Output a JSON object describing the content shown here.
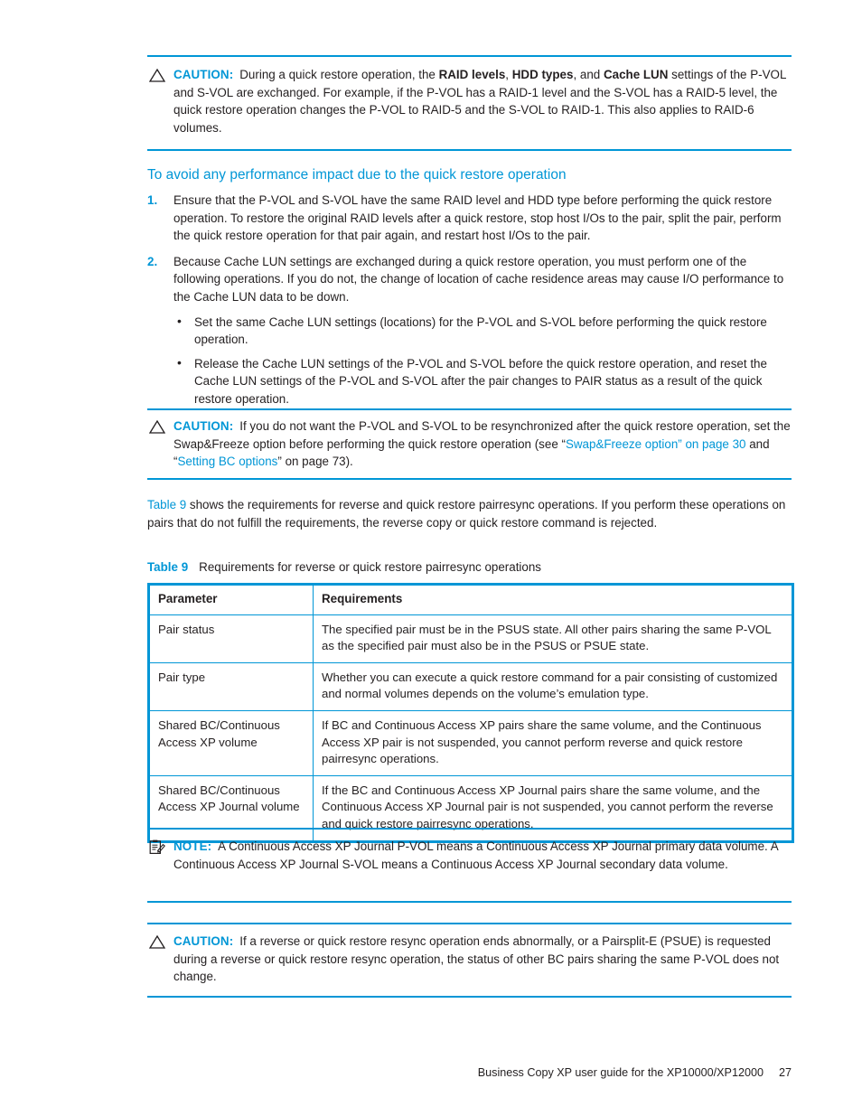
{
  "page": {
    "footer_text": "Business Copy XP user guide for the XP10000/XP12000",
    "page_number": "27",
    "accent_color": "#0096d6",
    "text_color": "#231f20"
  },
  "caution1": {
    "icon": "caution-triangle-icon",
    "label": "CAUTION:",
    "text_part1": "During a quick restore operation, the ",
    "bold1": "RAID levels",
    "text_part2": ", ",
    "bold2": "HDD types",
    "text_part3": ", and ",
    "bold3": "Cache LUN",
    "text_part4": " settings of the P-VOL and S-VOL are exchanged. For example, if the P-VOL has a RAID-1 level and the S-VOL has a RAID-5 level, the quick restore operation changes the P-VOL to RAID-5 and the S-VOL to RAID-1. This also applies to RAID-6 volumes."
  },
  "section": {
    "heading": "To avoid any performance impact due to the quick restore operation",
    "steps": [
      {
        "number": "1.",
        "text": "Ensure that the P-VOL and S-VOL have the same RAID level and HDD type before performing the quick restore operation. To restore the original RAID levels after a quick restore, stop host I/Os to the pair, split the pair, perform the quick restore operation for that pair again, and restart host I/Os to the pair."
      },
      {
        "number": "2.",
        "text": "Because Cache LUN settings are exchanged during a quick restore operation, you must perform one of the following operations. If you do not, the change of location of cache residence areas may cause I/O performance to the Cache LUN data to be down.",
        "bullets": [
          "Set the same Cache LUN settings (locations) for the P-VOL and S-VOL before performing the quick restore operation.",
          "Release the Cache LUN settings of the P-VOL and S-VOL before the quick restore operation, and reset the Cache LUN settings of the P-VOL and S-VOL after the pair changes to PAIR status as a result of the quick restore operation."
        ]
      }
    ]
  },
  "caution2": {
    "icon": "caution-triangle-icon",
    "label": "CAUTION:",
    "text_part1": "If you do not want the P-VOL and S-VOL to be resynchronized after the quick restore operation, set the Swap&Freeze option before performing the quick restore operation (see “",
    "link1": "Swap&Freeze option” on page 30",
    "text_part2": " and “",
    "link2": "Setting BC options",
    "text_part3": "” on page 73)."
  },
  "intro_para": {
    "link": "Table 9",
    "text": " shows the requirements for reverse and quick restore pairresync operations. If you perform these operations on pairs that do not fulfill the requirements, the reverse copy or quick restore command is rejected."
  },
  "table": {
    "caption_label": "Table 9",
    "caption_text": "Requirements for reverse or quick restore pairresync operations",
    "headers": [
      "Parameter",
      "Requirements"
    ],
    "rows": [
      {
        "parameter": "Pair status",
        "requirements": "The specified pair must be in the PSUS state. All other pairs sharing the same P-VOL as the specified pair must also be in the PSUS or PSUE state."
      },
      {
        "parameter": "Pair type",
        "requirements": "Whether you can execute a quick restore command for a pair consisting of customized and normal volumes depends on the volume’s emulation type."
      },
      {
        "parameter": "Shared BC/Continuous Access XP volume",
        "requirements": "If BC and Continuous Access XP pairs share the same volume, and the Continuous Access XP pair is not suspended, you cannot perform reverse and quick restore pairresync operations."
      },
      {
        "parameter": "Shared BC/Continuous Access XP Journal volume",
        "requirements": "If the BC and Continuous Access XP Journal pairs share the same volume, and the Continuous Access XP Journal pair is not suspended, you cannot perform the reverse and quick restore pairresync operations."
      }
    ]
  },
  "note": {
    "icon": "note-clipboard-icon",
    "label": "NOTE:",
    "text": "A Continuous Access XP Journal P-VOL means a Continuous Access XP Journal primary data volume. A Continuous Access XP Journal S-VOL means a Continuous Access XP Journal secondary data volume."
  },
  "caution3": {
    "icon": "caution-triangle-icon",
    "label": "CAUTION:",
    "text": "If a reverse or quick restore resync operation ends abnormally, or a Pairsplit-E (PSUE) is requested during a reverse or quick restore resync operation, the status of other BC pairs sharing the same P-VOL does not change."
  }
}
